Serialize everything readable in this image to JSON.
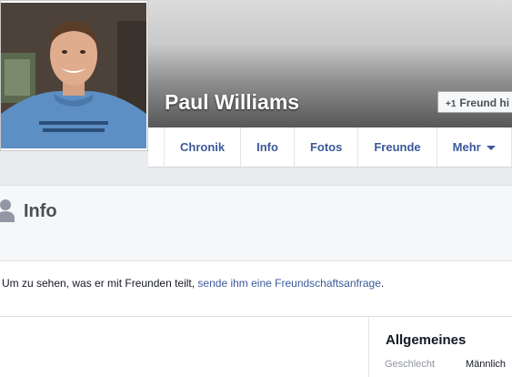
{
  "profile": {
    "name": "Paul Williams",
    "friend_button_icon": "+1",
    "friend_button_label": "Freund hi"
  },
  "nav": {
    "tabs": [
      {
        "label": "Chronik"
      },
      {
        "label": "Info"
      },
      {
        "label": "Fotos"
      },
      {
        "label": "Freunde"
      },
      {
        "label": "Mehr"
      }
    ]
  },
  "info": {
    "title": "Info",
    "message_prefix": "Um zu sehen, was er mit Freunden teilt, ",
    "message_link": "sende ihm eine Freundschaftsanfrage",
    "message_suffix": "."
  },
  "details": {
    "section_title": "Allgemeines",
    "fields": [
      {
        "label": "Geschlecht",
        "value": "Männlich"
      }
    ]
  },
  "colors": {
    "link": "#3b5998",
    "page_background": "#e9ebee"
  },
  "icons": {
    "person": "person-silhouette-icon",
    "dropdown": "chevron-down-icon"
  }
}
